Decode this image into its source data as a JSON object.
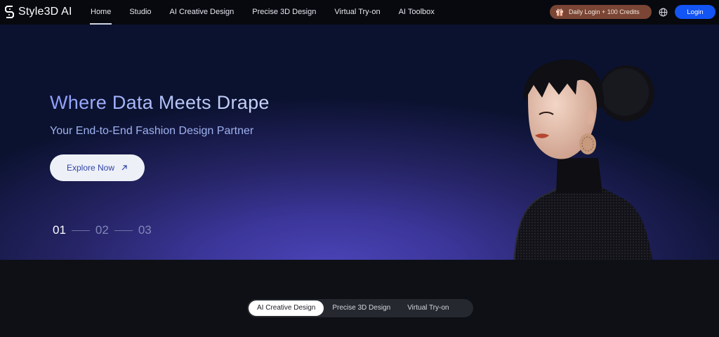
{
  "brand": {
    "name": "Style3D AI"
  },
  "nav": {
    "items": [
      {
        "label": "Home",
        "active": true
      },
      {
        "label": "Studio",
        "active": false
      },
      {
        "label": "AI Creative Design",
        "active": false
      },
      {
        "label": "Precise 3D Design",
        "active": false
      },
      {
        "label": "Virtual Try-on",
        "active": false
      },
      {
        "label": "AI Toolbox",
        "active": false
      }
    ]
  },
  "header": {
    "credits_label": "Daily Login + 100 Credits",
    "login_label": "Login",
    "icons": {
      "gift": "gift-icon",
      "language": "globe-icon"
    }
  },
  "hero": {
    "title": "Where Data Meets Drape",
    "subtitle": "Your End-to-End Fashion Design Partner",
    "cta_label": "Explore Now",
    "cta_icon": "arrow-up-right-icon",
    "pager": [
      "01",
      "02",
      "03"
    ],
    "pager_active": 0
  },
  "feature_tabs": {
    "items": [
      "AI Creative Design",
      "Precise 3D Design",
      "Virtual Try-on"
    ],
    "active": 0
  },
  "colors": {
    "accent": "#1354f4",
    "credits_bg": "#7a4534",
    "hero_title": "#a5b4f9"
  }
}
